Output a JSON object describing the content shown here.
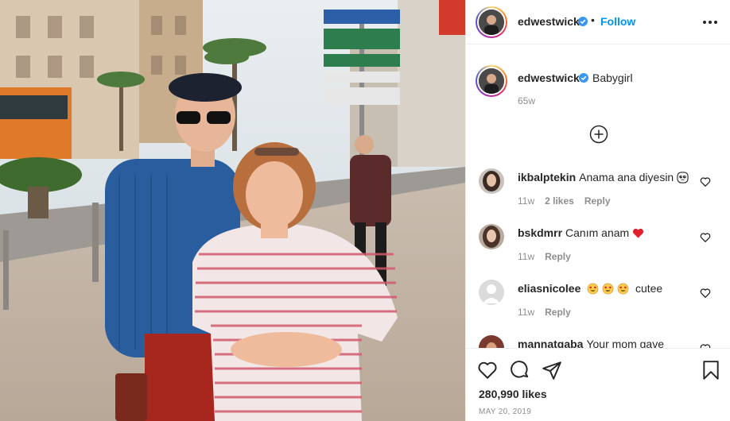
{
  "post": {
    "username": "edwestwick",
    "follow_label": "Follow",
    "separator": "•"
  },
  "caption": {
    "username": "edwestwick",
    "text": "Babygirl",
    "age": "65w"
  },
  "comments": [
    {
      "username": "ikbalptekin",
      "text": "Anama ana diyesin",
      "emoji": "pleading-face-emoji",
      "age": "11w",
      "likes": "2 likes",
      "reply": "Reply"
    },
    {
      "username": "bskdmrr",
      "text": "Canım anam",
      "emoji": "red-heart-emoji",
      "age": "11w",
      "reply": "Reply"
    },
    {
      "username": "eliasnicolee",
      "text": "cutee",
      "emoji": "heart-eyes-emoji",
      "age": "11w",
      "reply": "Reply"
    },
    {
      "username": "mannatgaba",
      "text": "Your mom gave"
    }
  ],
  "engagement": {
    "likes": "280,990 likes",
    "date": "MAY 20, 2019"
  },
  "colors": {
    "accent": "#0095f6",
    "verified": "#3897f0",
    "muted": "#8e8e8e",
    "text": "#262626"
  },
  "icons": [
    "more-options-icon",
    "add-circle-icon",
    "heart-icon",
    "comment-icon",
    "share-icon",
    "bookmark-icon",
    "verified-icon"
  ]
}
